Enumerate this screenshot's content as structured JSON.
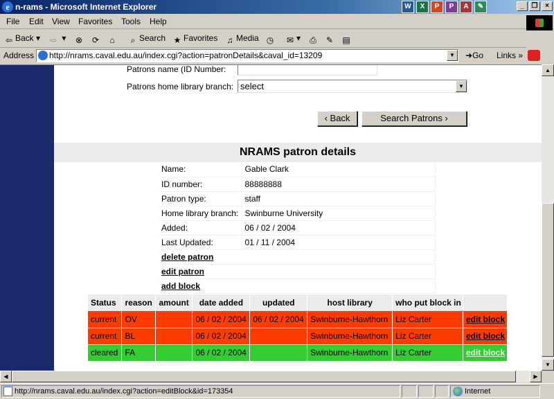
{
  "window": {
    "title": "n-rams - Microsoft Internet Explorer",
    "tray_icons": [
      "word-icon",
      "excel-icon",
      "powerpoint-icon",
      "publisher-icon",
      "access-icon",
      "paint-icon"
    ]
  },
  "menu": [
    "File",
    "Edit",
    "View",
    "Favorites",
    "Tools",
    "Help"
  ],
  "toolbar": {
    "back": "Back",
    "search": "Search",
    "favorites": "Favorites",
    "media": "Media"
  },
  "address": {
    "label": "Address",
    "url": "http://nrams.caval.edu.au/index.cgi?action=patronDetails&caval_id=13209",
    "go": "Go",
    "links": "Links"
  },
  "search_form": {
    "id_label": "Patrons name (ID Number:",
    "id_value": "",
    "branch_label": "Patrons home library branch:",
    "branch_value": "select",
    "back_button": "‹ Back",
    "search_button": "Search Patrons ›"
  },
  "details": {
    "header": "NRAMS patron details",
    "rows": [
      {
        "label": "Name:",
        "value": "Gable Clark"
      },
      {
        "label": "ID number:",
        "value": "88888888"
      },
      {
        "label": "Patron type:",
        "value": "staff"
      },
      {
        "label": "Home library branch:",
        "value": "Swinburne University"
      },
      {
        "label": "Added:",
        "value": "06 / 02 / 2004"
      },
      {
        "label": "Last Updated:",
        "value": "01 / 11 / 2004"
      }
    ],
    "actions": [
      "delete patron",
      "edit patron",
      "add block"
    ]
  },
  "blocks": {
    "columns": [
      "Status",
      "reason",
      "amount",
      "date added",
      "updated",
      "host library",
      "who put block in",
      ""
    ],
    "rows": [
      {
        "status": "current",
        "reason": "OV",
        "amount": "",
        "date_added": "06 / 02 / 2004",
        "updated": "06 / 02 / 2004",
        "host_library": "Swinburne-Hawthorn",
        "who": "Liz Carter",
        "action": "edit block"
      },
      {
        "status": "current",
        "reason": "BL",
        "amount": "",
        "date_added": "06 / 02 / 2004",
        "updated": "",
        "host_library": "Swinburne-Hawthorn",
        "who": "Liz Carter",
        "action": "edit block"
      },
      {
        "status": "cleared",
        "reason": "FA",
        "amount": "",
        "date_added": "06 / 02 / 2004",
        "updated": "",
        "host_library": "Swinburne-Hawthorn",
        "who": "Liz Carter",
        "action": "edit block"
      }
    ]
  },
  "status_bar": {
    "text": "http://nrams.caval.edu.au/index.cgi?action=editBlock&id=173354",
    "zone": "Internet"
  },
  "colors": {
    "sidebar": "#1a2a6b",
    "current_row": "#ff3c00",
    "cleared_row": "#33cc33"
  }
}
